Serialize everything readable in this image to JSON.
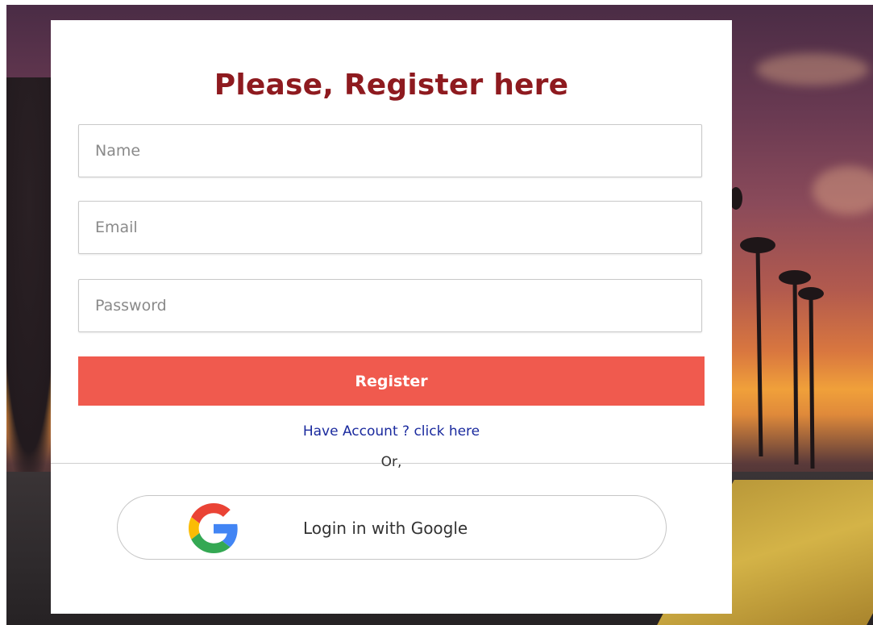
{
  "form": {
    "title": "Please, Register here",
    "name_placeholder": "Name",
    "email_placeholder": "Email",
    "password_placeholder": "Password",
    "register_label": "Register",
    "have_account_label": "Have Account ? click here",
    "or_label": "Or,",
    "google_label": "Login in with Google"
  },
  "colors": {
    "title": "#8e1a1f",
    "register_button": "#f05a4e",
    "link": "#1a2a9e"
  },
  "icons": {
    "google": "google-g-icon"
  }
}
